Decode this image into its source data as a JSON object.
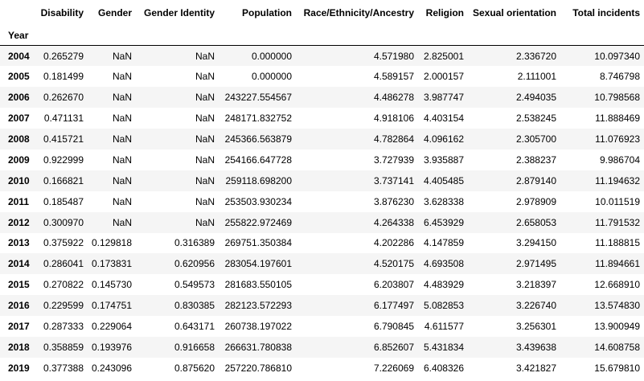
{
  "index_name": "Year",
  "columns": [
    "Disability",
    "Gender",
    "Gender Identity",
    "Population",
    "Race/Ethnicity/Ancestry",
    "Religion",
    "Sexual orientation",
    "Total incidents"
  ],
  "rows": [
    {
      "year": "2004",
      "cells": [
        "0.265279",
        "NaN",
        "NaN",
        "0.000000",
        "4.571980",
        "2.825001",
        "2.336720",
        "10.097340"
      ]
    },
    {
      "year": "2005",
      "cells": [
        "0.181499",
        "NaN",
        "NaN",
        "0.000000",
        "4.589157",
        "2.000157",
        "2.111001",
        "8.746798"
      ]
    },
    {
      "year": "2006",
      "cells": [
        "0.262670",
        "NaN",
        "NaN",
        "243227.554567",
        "4.486278",
        "3.987747",
        "2.494035",
        "10.798568"
      ]
    },
    {
      "year": "2007",
      "cells": [
        "0.471131",
        "NaN",
        "NaN",
        "248171.832752",
        "4.918106",
        "4.403154",
        "2.538245",
        "11.888469"
      ]
    },
    {
      "year": "2008",
      "cells": [
        "0.415721",
        "NaN",
        "NaN",
        "245366.563879",
        "4.782864",
        "4.096162",
        "2.305700",
        "11.076923"
      ]
    },
    {
      "year": "2009",
      "cells": [
        "0.922999",
        "NaN",
        "NaN",
        "254166.647728",
        "3.727939",
        "3.935887",
        "2.388237",
        "9.986704"
      ]
    },
    {
      "year": "2010",
      "cells": [
        "0.166821",
        "NaN",
        "NaN",
        "259118.698200",
        "3.737141",
        "4.405485",
        "2.879140",
        "11.194632"
      ]
    },
    {
      "year": "2011",
      "cells": [
        "0.185487",
        "NaN",
        "NaN",
        "253503.930234",
        "3.876230",
        "3.628338",
        "2.978909",
        "10.011519"
      ]
    },
    {
      "year": "2012",
      "cells": [
        "0.300970",
        "NaN",
        "NaN",
        "255822.972469",
        "4.264338",
        "6.453929",
        "2.658053",
        "11.791532"
      ]
    },
    {
      "year": "2013",
      "cells": [
        "0.375922",
        "0.129818",
        "0.316389",
        "269751.350384",
        "4.202286",
        "4.147859",
        "3.294150",
        "11.188815"
      ]
    },
    {
      "year": "2014",
      "cells": [
        "0.286041",
        "0.173831",
        "0.620956",
        "283054.197601",
        "4.520175",
        "4.693508",
        "2.971495",
        "11.894661"
      ]
    },
    {
      "year": "2015",
      "cells": [
        "0.270822",
        "0.145730",
        "0.549573",
        "281683.550105",
        "6.203807",
        "4.483929",
        "3.218397",
        "12.668910"
      ]
    },
    {
      "year": "2016",
      "cells": [
        "0.229599",
        "0.174751",
        "0.830385",
        "282123.572293",
        "6.177497",
        "5.082853",
        "3.226740",
        "13.574830"
      ]
    },
    {
      "year": "2017",
      "cells": [
        "0.287333",
        "0.229064",
        "0.643171",
        "260738.197022",
        "6.790845",
        "4.611577",
        "3.256301",
        "13.900949"
      ]
    },
    {
      "year": "2018",
      "cells": [
        "0.358859",
        "0.193976",
        "0.916658",
        "266631.780838",
        "6.852607",
        "5.431834",
        "3.439638",
        "14.608758"
      ]
    },
    {
      "year": "2019",
      "cells": [
        "0.377388",
        "0.243096",
        "0.875620",
        "257220.786810",
        "7.226069",
        "6.408326",
        "3.421827",
        "15.679810"
      ]
    }
  ]
}
